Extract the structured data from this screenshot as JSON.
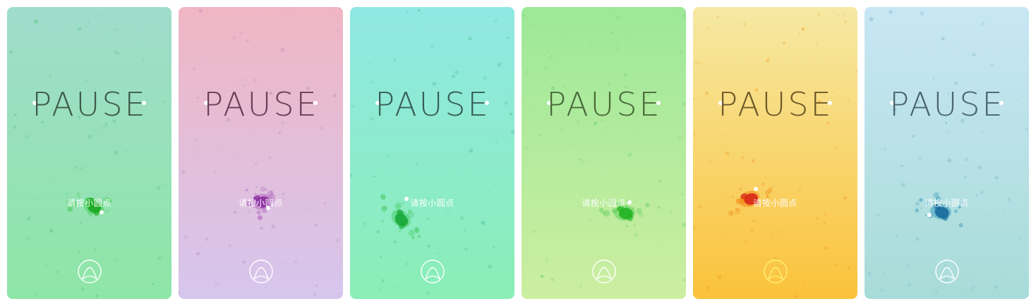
{
  "screens": [
    {
      "title": "PAUSE",
      "hint": "请按小圆点",
      "bg_top": "#a0dccc",
      "bg_bottom": "#8ee6a6",
      "title_color": "#3f5a4c",
      "blob": "#1aa820",
      "blob_light": "#4cd060",
      "logo_color": "#ffffff",
      "specks": "#5fc48a"
    },
    {
      "title": "PAUSE",
      "hint": "请按小圆点",
      "bg_top": "#f0b6c4",
      "bg_bottom": "#d6c6ee",
      "title_color": "#6a4058",
      "blob": "#8a2ea0",
      "blob_light": "#b068c0",
      "logo_color": "#ffffff",
      "specks": "#b890b8"
    },
    {
      "title": "PAUSE",
      "hint": "请按小圆点",
      "bg_top": "#90e8e4",
      "bg_bottom": "#8aeeb6",
      "title_color": "#3a5e58",
      "blob": "#18a838",
      "blob_light": "#4ccc6a",
      "logo_color": "#ffffff",
      "specks": "#4cc4a0"
    },
    {
      "title": "PAUSE",
      "hint": "请按小圆点",
      "bg_top": "#9de89a",
      "bg_bottom": "#cceea0",
      "title_color": "#4a6a3a",
      "blob": "#22b422",
      "blob_light": "#62d060",
      "logo_color": "#ffffff",
      "specks": "#6cd070"
    },
    {
      "title": "PAUSE",
      "hint": "请按小圆点",
      "bg_top": "#f6e9a4",
      "bg_bottom": "#fbc23a",
      "title_color": "#6f5a2a",
      "blob": "#d82818",
      "blob_light": "#f08c1c",
      "logo_color": "#fff27a",
      "specks": "#f0a02a"
    },
    {
      "title": "PAUSE",
      "hint": "请按小圆点",
      "bg_top": "#c8e6f4",
      "bg_bottom": "#a8dcd8",
      "title_color": "#4a6470",
      "blob": "#1a6c9c",
      "blob_light": "#3d9cbc",
      "logo_color": "#ffffff",
      "specks": "#80b8cc"
    }
  ]
}
